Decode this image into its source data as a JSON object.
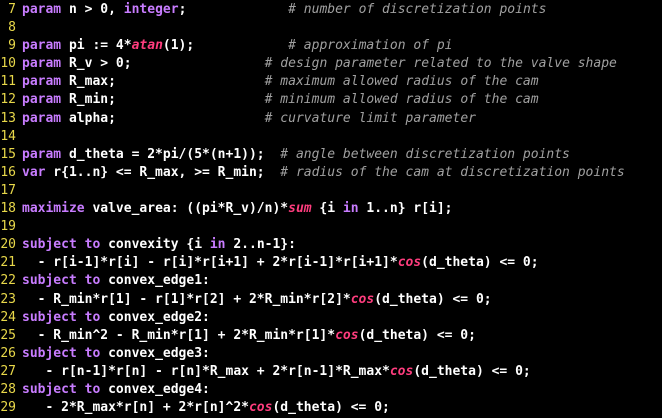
{
  "colors": {
    "background": "#000000",
    "line_number": "#e8d84a",
    "keyword": "#c87cff",
    "builtin_function": "#ff3d7e",
    "text": "#ffffff",
    "comment": "#a0a0a0"
  },
  "lines": [
    {
      "n": "7",
      "tokens": [
        {
          "t": "kw",
          "v": "param"
        },
        {
          "t": "txt",
          "v": " n > 0, "
        },
        {
          "t": "kw",
          "v": "integer"
        },
        {
          "t": "txt",
          "v": ";"
        },
        {
          "t": "txt",
          "v": "             "
        },
        {
          "t": "cm",
          "v": "# number of discretization points"
        }
      ]
    },
    {
      "n": "8",
      "tokens": []
    },
    {
      "n": "9",
      "tokens": [
        {
          "t": "kw",
          "v": "param"
        },
        {
          "t": "txt",
          "v": " pi := 4*"
        },
        {
          "t": "fn",
          "v": "atan"
        },
        {
          "t": "txt",
          "v": "(1);"
        },
        {
          "t": "txt",
          "v": "            "
        },
        {
          "t": "cm",
          "v": "# approximation of pi"
        }
      ]
    },
    {
      "n": "10",
      "tokens": [
        {
          "t": "kw",
          "v": "param"
        },
        {
          "t": "txt",
          "v": " R_v > 0;"
        },
        {
          "t": "txt",
          "v": "                 "
        },
        {
          "t": "cm",
          "v": "# design parameter related to the valve shape"
        }
      ]
    },
    {
      "n": "11",
      "tokens": [
        {
          "t": "kw",
          "v": "param"
        },
        {
          "t": "txt",
          "v": " R_max;"
        },
        {
          "t": "txt",
          "v": "                   "
        },
        {
          "t": "cm",
          "v": "# maximum allowed radius of the cam"
        }
      ]
    },
    {
      "n": "12",
      "tokens": [
        {
          "t": "kw",
          "v": "param"
        },
        {
          "t": "txt",
          "v": " R_min;"
        },
        {
          "t": "txt",
          "v": "                   "
        },
        {
          "t": "cm",
          "v": "# minimum allowed radius of the cam"
        }
      ]
    },
    {
      "n": "13",
      "tokens": [
        {
          "t": "kw",
          "v": "param"
        },
        {
          "t": "txt",
          "v": " alpha;"
        },
        {
          "t": "txt",
          "v": "                   "
        },
        {
          "t": "cm",
          "v": "# curvature limit parameter"
        }
      ]
    },
    {
      "n": "14",
      "tokens": []
    },
    {
      "n": "15",
      "tokens": [
        {
          "t": "kw",
          "v": "param"
        },
        {
          "t": "txt",
          "v": " d_theta = 2*pi/(5*(n+1));"
        },
        {
          "t": "txt",
          "v": "  "
        },
        {
          "t": "cm",
          "v": "# angle between discretization points"
        }
      ]
    },
    {
      "n": "16",
      "tokens": [
        {
          "t": "kw",
          "v": "var"
        },
        {
          "t": "txt",
          "v": " r{1..n} <= R_max, >= R_min;"
        },
        {
          "t": "txt",
          "v": "  "
        },
        {
          "t": "cm",
          "v": "# radius of the cam at discretization points"
        }
      ]
    },
    {
      "n": "17",
      "tokens": []
    },
    {
      "n": "18",
      "tokens": [
        {
          "t": "kw",
          "v": "maximize"
        },
        {
          "t": "txt",
          "v": " valve_area: ((pi*R_v)/n)*"
        },
        {
          "t": "fn",
          "v": "sum"
        },
        {
          "t": "txt",
          "v": " {i "
        },
        {
          "t": "kw",
          "v": "in"
        },
        {
          "t": "txt",
          "v": " 1..n} r[i];"
        }
      ]
    },
    {
      "n": "19",
      "tokens": []
    },
    {
      "n": "20",
      "tokens": [
        {
          "t": "kw",
          "v": "subject to"
        },
        {
          "t": "txt",
          "v": " convexity {i "
        },
        {
          "t": "kw",
          "v": "in"
        },
        {
          "t": "txt",
          "v": " 2..n-1}:"
        }
      ]
    },
    {
      "n": "21",
      "tokens": [
        {
          "t": "txt",
          "v": "  - r[i-1]*r[i] - r[i]*r[i+1] + 2*r[i-1]*r[i+1]*"
        },
        {
          "t": "fn",
          "v": "cos"
        },
        {
          "t": "txt",
          "v": "(d_theta) <= 0;"
        }
      ]
    },
    {
      "n": "22",
      "tokens": [
        {
          "t": "kw",
          "v": "subject to"
        },
        {
          "t": "txt",
          "v": " convex_edge1:"
        }
      ]
    },
    {
      "n": "23",
      "tokens": [
        {
          "t": "txt",
          "v": "  - R_min*r[1] - r[1]*r[2] + 2*R_min*r[2]*"
        },
        {
          "t": "fn",
          "v": "cos"
        },
        {
          "t": "txt",
          "v": "(d_theta) <= 0;"
        }
      ]
    },
    {
      "n": "24",
      "tokens": [
        {
          "t": "kw",
          "v": "subject to"
        },
        {
          "t": "txt",
          "v": " convex_edge2:"
        }
      ]
    },
    {
      "n": "25",
      "tokens": [
        {
          "t": "txt",
          "v": "  - R_min^2 - R_min*r[1] + 2*R_min*r[1]*"
        },
        {
          "t": "fn",
          "v": "cos"
        },
        {
          "t": "txt",
          "v": "(d_theta) <= 0;"
        }
      ]
    },
    {
      "n": "26",
      "tokens": [
        {
          "t": "kw",
          "v": "subject to"
        },
        {
          "t": "txt",
          "v": " convex_edge3:"
        }
      ]
    },
    {
      "n": "27",
      "tokens": [
        {
          "t": "txt",
          "v": "   - r[n-1]*r[n] - r[n]*R_max + 2*r[n-1]*R_max*"
        },
        {
          "t": "fn",
          "v": "cos"
        },
        {
          "t": "txt",
          "v": "(d_theta) <= 0;"
        }
      ]
    },
    {
      "n": "28",
      "tokens": [
        {
          "t": "kw",
          "v": "subject to"
        },
        {
          "t": "txt",
          "v": " convex_edge4:"
        }
      ]
    },
    {
      "n": "29",
      "tokens": [
        {
          "t": "txt",
          "v": "   - 2*R_max*r[n] + 2*r[n]^2*"
        },
        {
          "t": "fn",
          "v": "cos"
        },
        {
          "t": "txt",
          "v": "(d_theta) <= 0;"
        }
      ]
    }
  ]
}
